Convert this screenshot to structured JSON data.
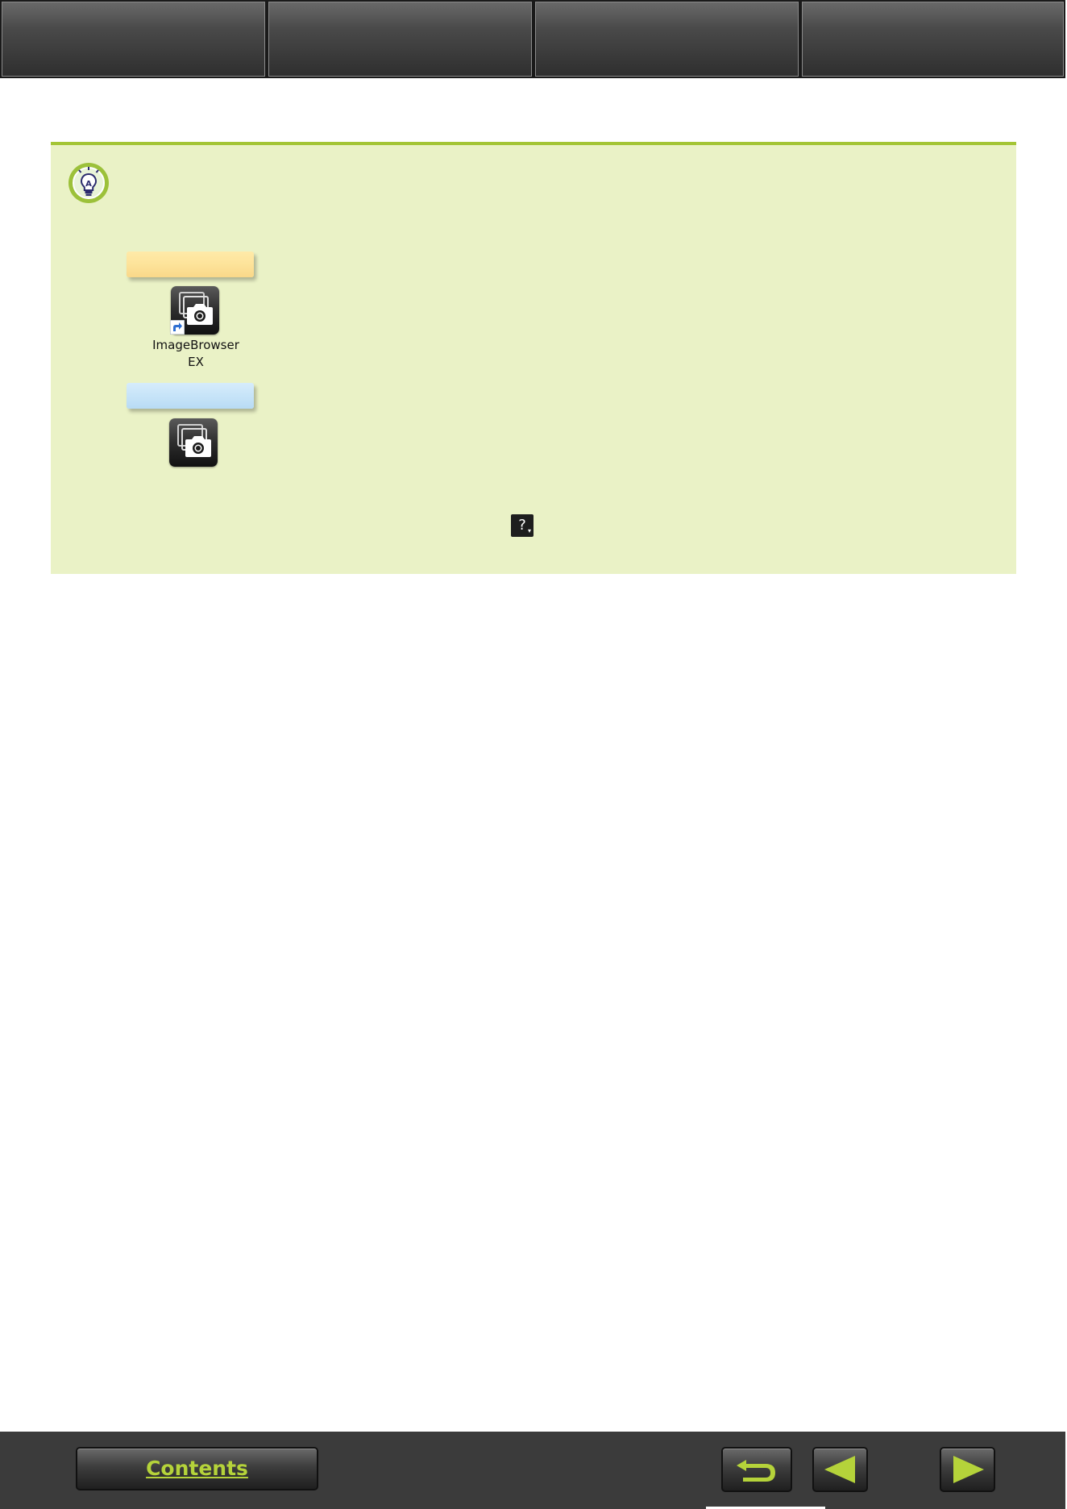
{
  "top_nav": {
    "tabs": [
      "",
      "",
      "",
      ""
    ]
  },
  "hint": {
    "icon": "lightbulb-icon",
    "accent_color": "#a4c535",
    "background_color": "#eaf2c6",
    "windows_icon_label": "ImageBrowser\nEX",
    "help_icon_glyph": "?"
  },
  "bottom_bar": {
    "contents_label": "Contents",
    "back_icon": "return-arrow-icon",
    "prev_icon": "left-triangle-icon",
    "next_icon": "right-triangle-icon",
    "accent_color": "#b5d33a"
  }
}
